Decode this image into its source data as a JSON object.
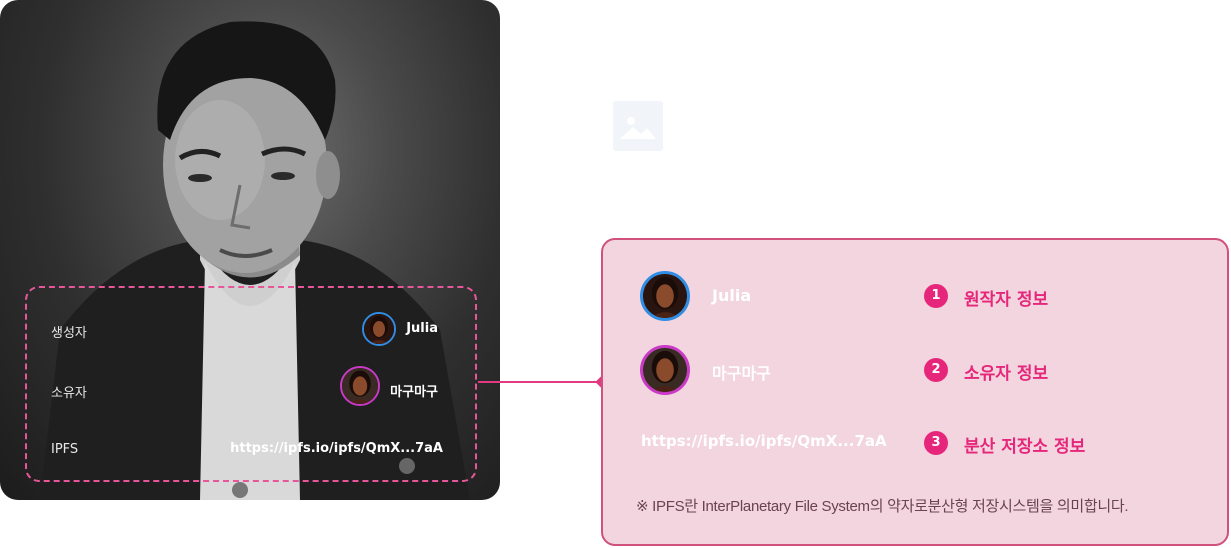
{
  "photo_card": {
    "rows": [
      {
        "label": "생성자",
        "value": "Julia",
        "avatar": "avatar-julia"
      },
      {
        "label": "소유자",
        "value": "마구마구",
        "avatar": "avatar-magumagu"
      },
      {
        "label": "IPFS",
        "value": "https://ipfs.io/ipfs/QmX...7aA"
      }
    ]
  },
  "legend": {
    "items": [
      {
        "name": "Julia",
        "number": "1",
        "title": "원작자 정보"
      },
      {
        "name": "마구마구",
        "number": "2",
        "title": "소유자 정보"
      },
      {
        "url": "https://ipfs.io/ipfs/QmX...7aA",
        "number": "3",
        "title": "분산 저장소 정보"
      }
    ],
    "note": "※ IPFS란 InterPlanetary File System의 약자로분산형 저장시스템을 의미합니다."
  },
  "colors": {
    "accent": "#e6267a",
    "dashed_border": "#e8569a",
    "legend_bg": "#f2d5df",
    "avatar_ring_creator": "#2f8de4",
    "avatar_ring_owner": "#c93ac6"
  },
  "icons": {
    "placeholder": "image-placeholder-icon"
  }
}
